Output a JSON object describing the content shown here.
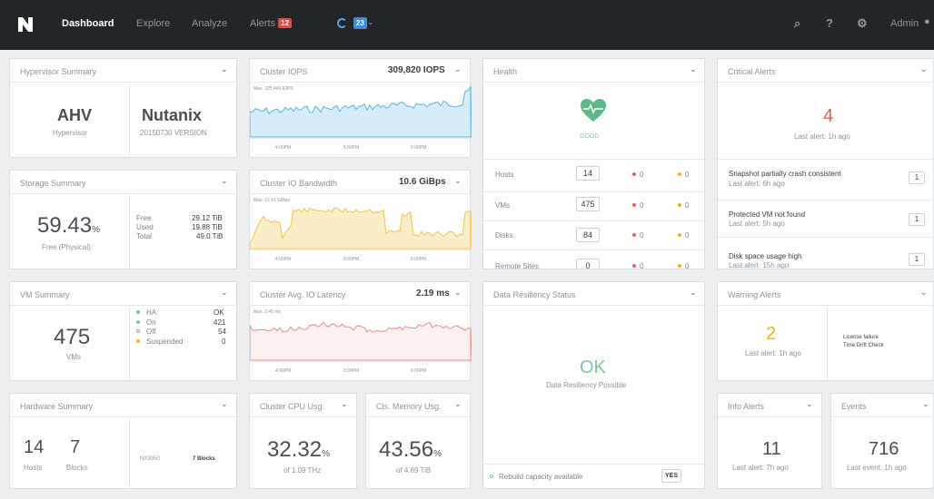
{
  "topbar": {
    "nav": [
      "Dashboard",
      "Explore",
      "Analyze",
      "Alerts"
    ],
    "alerts_count": "12",
    "tasks_count": "23",
    "admin": "Admin"
  },
  "hypervisor": {
    "title": "Hypervisor Summary",
    "type": "AHV",
    "type_label": "Hypervisor",
    "vendor": "Nutanix",
    "version": "20150730 VERSION"
  },
  "storage": {
    "title": "Storage Summary",
    "value": "59.43",
    "unit": "%",
    "label": "Free (Physical)",
    "rows": [
      [
        "Free",
        "29.12 TiB"
      ],
      [
        "Used",
        "19.88 TiB"
      ],
      [
        "Total",
        "49.0 TiB"
      ]
    ]
  },
  "vm": {
    "title": "VM Summary",
    "count": "475",
    "label": "VMs",
    "rows": [
      [
        "HA",
        "OK"
      ],
      [
        "On",
        "421"
      ],
      [
        "Off",
        "54"
      ],
      [
        "Suspended",
        "0"
      ]
    ]
  },
  "hardware": {
    "title": "Hardware Summary",
    "hosts": "14",
    "hosts_label": "Hosts",
    "blocks": "7",
    "blocks_label": "Blocks",
    "model": "NX3050",
    "model_blocks": "7 Blocks"
  },
  "iops": {
    "title": "Cluster IOPS",
    "value": "309,820 IOPS",
    "max": "Max. 325,449 IOPS",
    "ticks": [
      "4:00PM",
      "5:00PM",
      "6:00PM"
    ]
  },
  "bandwidth": {
    "title": "Cluster IO Bandwidth",
    "value": "10.6 GiBps",
    "max": "Max. 12.41 GiBps",
    "ticks": [
      "4:00PM",
      "5:00PM",
      "6:00PM"
    ]
  },
  "latency": {
    "title": "Cluster Avg. IO Latency",
    "value": "2.19 ms",
    "max": "Max. 2.45 ms",
    "ticks": [
      "4:00PM",
      "5:00PM",
      "6:00PM"
    ]
  },
  "cpu": {
    "title": "Cluster CPU Usg.",
    "value": "32.32",
    "unit": "%",
    "label": "of 1.09 THz"
  },
  "mem": {
    "title": "Cls. Memory Usg.",
    "value": "43.56",
    "unit": "%",
    "label": "of 4.69 TiB"
  },
  "health": {
    "title": "Health",
    "status": "GOOD",
    "rows": [
      [
        "Hosts",
        "14",
        "0",
        "0"
      ],
      [
        "VMs",
        "475",
        "0",
        "0"
      ],
      [
        "Disks",
        "84",
        "0",
        "0"
      ],
      [
        "Remote Sites",
        "0",
        "0",
        "0"
      ]
    ]
  },
  "resiliency": {
    "title": "Data Resiliency Status",
    "status": "OK",
    "label": "Data Resiliency Possible",
    "rebuild": "Rebuild capacity available",
    "rebuild_value": "YES"
  },
  "critical": {
    "title": "Critical Alerts",
    "count": "4",
    "last": "Last alert: 1h ago",
    "items": [
      [
        "Snapshot partially crash consistent",
        "Last alert: 6h ago",
        "1"
      ],
      [
        "Protected VM not found",
        "Last alert: 5h ago",
        "1"
      ],
      [
        "Disk space usage high",
        "Last alert: 15h ago",
        "1"
      ]
    ]
  },
  "warning": {
    "title": "Warning Alerts",
    "count": "2",
    "last": "Last alert: 1h ago",
    "items": [
      "License failure",
      "Time Drift Check"
    ]
  },
  "info": {
    "title": "Info Alerts",
    "count": "11",
    "last": "Last alert: 7h ago"
  },
  "events": {
    "title": "Events",
    "count": "716",
    "last": "Last event: 1h ago"
  },
  "colors": {
    "accent": "#3f8be0",
    "good": "#5bb98a",
    "warning": "#f5b400",
    "critical": "#e8604c",
    "chart_blue": "#5ab4e6",
    "chart_yellow": "#f3c44a",
    "chart_red": "#e98c8c"
  }
}
